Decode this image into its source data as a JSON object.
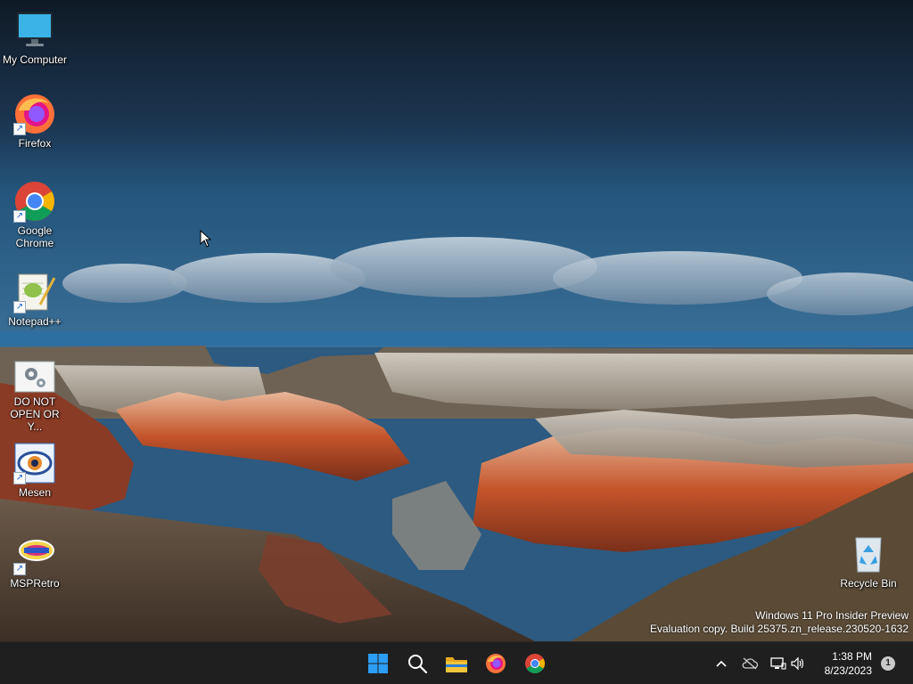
{
  "desktop": {
    "icons": [
      {
        "label": "My Computer",
        "icon": "monitor-icon"
      },
      {
        "label": "Firefox",
        "icon": "firefox-icon",
        "shortcut": true
      },
      {
        "label": "Google Chrome",
        "icon": "chrome-icon",
        "shortcut": true
      },
      {
        "label": "Notepad++",
        "icon": "notepadpp-icon",
        "shortcut": true
      },
      {
        "label": "DO NOT OPEN OR Y...",
        "icon": "settings-gear-icon"
      },
      {
        "label": "Mesen",
        "icon": "mesen-icon",
        "shortcut": true
      },
      {
        "label": "MSPRetro",
        "icon": "mspretro-icon",
        "shortcut": true
      }
    ],
    "recycle_bin": {
      "label": "Recycle Bin",
      "icon": "recycle-bin-icon"
    },
    "watermark": {
      "line1": "Windows 11 Pro Insider Preview",
      "line2": "Evaluation copy. Build 25375.zn_release.230520-1632"
    }
  },
  "taskbar": {
    "apps": [
      {
        "name": "Start",
        "icon": "windows-start-icon"
      },
      {
        "name": "Search",
        "icon": "search-icon"
      },
      {
        "name": "File Explorer",
        "icon": "folder-icon"
      },
      {
        "name": "Firefox",
        "icon": "firefox-icon"
      },
      {
        "name": "Google Chrome",
        "icon": "chrome-icon"
      }
    ],
    "tray": {
      "chevron": "^",
      "time": "1:38 PM",
      "date": "8/23/2023",
      "notification_count": "1"
    }
  },
  "colors": {
    "taskbar_bg": "#1f1f1f",
    "start_blue": "#2b9df4",
    "folder_yellow": "#f3c33b"
  }
}
